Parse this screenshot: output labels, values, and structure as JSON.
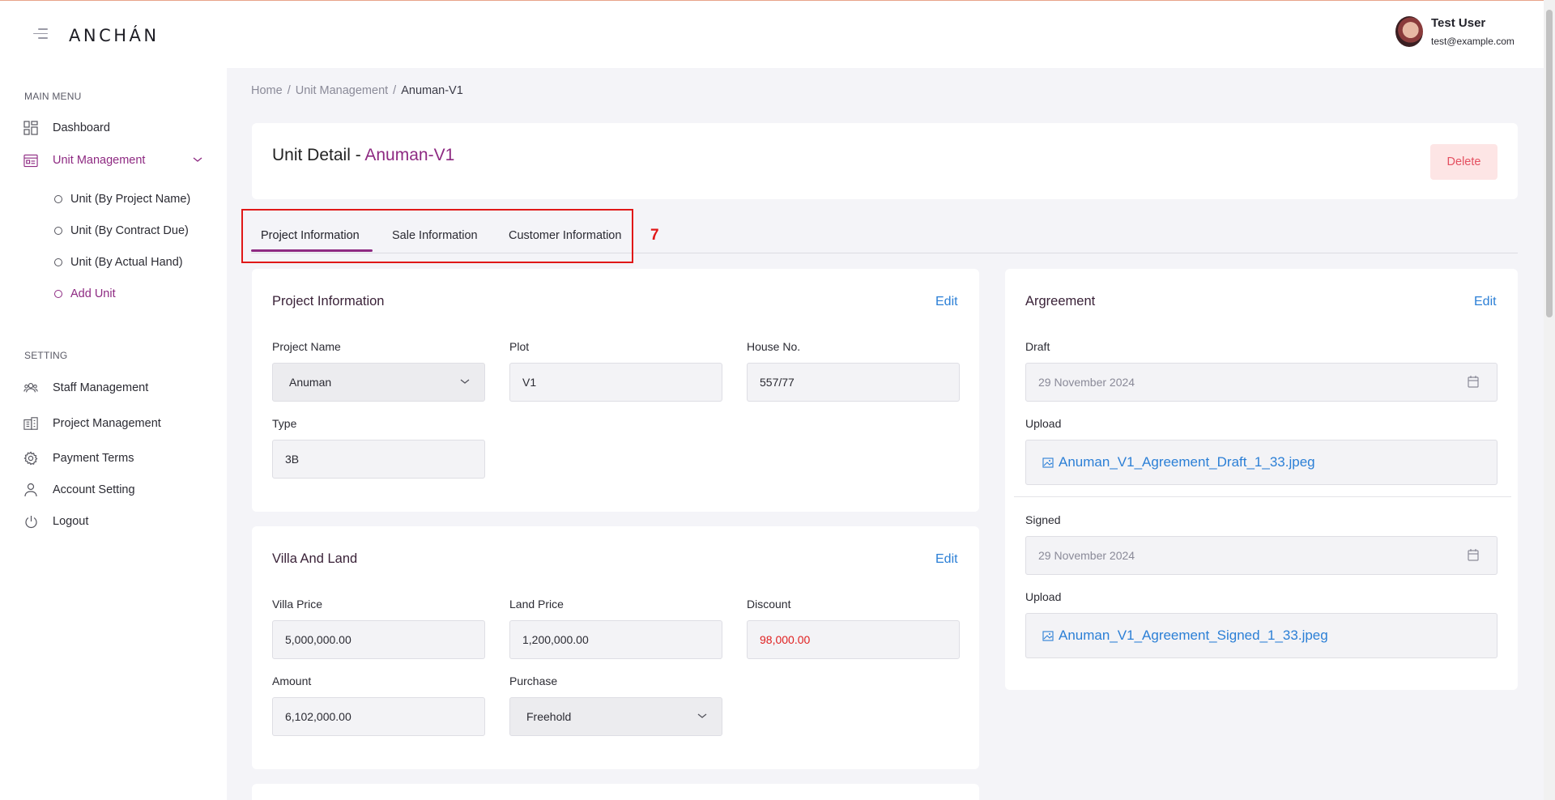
{
  "app": {
    "logo": "ANCHÁN"
  },
  "user": {
    "name": "Test User",
    "email": "test@example.com"
  },
  "sidebar": {
    "main_menu_title": "MAIN MENU",
    "dashboard": "Dashboard",
    "unit_management": "Unit Management",
    "sub_items": [
      "Unit (By Project Name)",
      "Unit (By Contract Due)",
      "Unit (By Actual Hand)",
      "Add Unit"
    ],
    "setting_title": "SETTING",
    "settings": [
      "Staff Management",
      "Project Management",
      "Payment Terms",
      "Account Setting",
      "Logout"
    ]
  },
  "breadcrumb": {
    "home": "Home",
    "sep": "/",
    "section": "Unit Management",
    "current": "Anuman-V1"
  },
  "header": {
    "title_prefix": "Unit Detail - ",
    "title_unit": "Anuman-V1",
    "delete_label": "Delete"
  },
  "tabs": [
    "Project Information",
    "Sale Information",
    "Customer Information"
  ],
  "annotation": "7",
  "project_info": {
    "title": "Project Information",
    "edit": "Edit",
    "project_name_label": "Project Name",
    "project_name": "Anuman",
    "plot_label": "Plot",
    "plot": "V1",
    "house_no_label": "House No.",
    "house_no": "557/77",
    "type_label": "Type",
    "type": "3B"
  },
  "villa": {
    "title": "Villa And Land",
    "edit": "Edit",
    "villa_price_label": "Villa Price",
    "villa_price": "5,000,000.00",
    "land_price_label": "Land Price",
    "land_price": "1,200,000.00",
    "discount_label": "Discount",
    "discount": "98,000.00",
    "amount_label": "Amount",
    "amount": "6,102,000.00",
    "purchase_label": "Purchase",
    "purchase": "Freehold"
  },
  "agreement": {
    "title": "Argreement",
    "edit": "Edit",
    "draft_label": "Draft",
    "draft_date": "29 November 2024",
    "upload_label": "Upload",
    "draft_file": "Anuman_V1_Agreement_Draft_1_33.jpeg",
    "signed_label": "Signed",
    "signed_date": "29 November 2024",
    "signed_upload_label": "Upload",
    "signed_file": "Anuman_V1_Agreement_Signed_1_33.jpeg"
  },
  "colors": {
    "accent": "#8e2a82",
    "link": "#2b7fd6",
    "danger": "#e02020"
  }
}
